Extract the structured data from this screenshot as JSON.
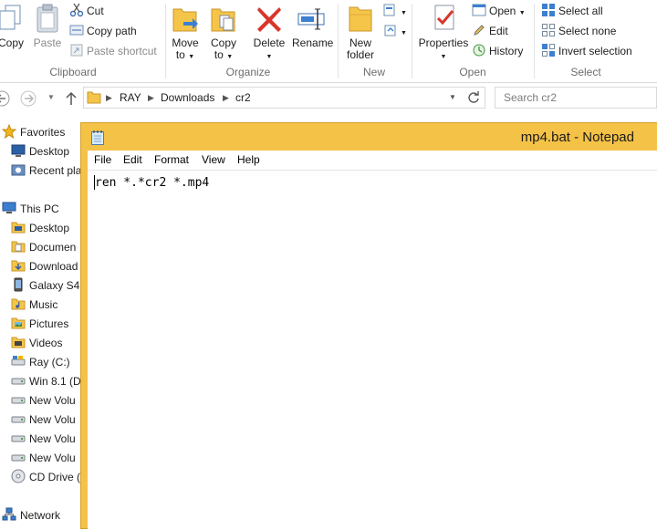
{
  "ribbon": {
    "clipboard": {
      "group_label": "Clipboard",
      "copy": "Copy",
      "paste": "Paste",
      "cut": "Cut",
      "copy_path": "Copy path",
      "paste_shortcut": "Paste shortcut"
    },
    "organize": {
      "group_label": "Organize",
      "move_to_1": "Move",
      "move_to_2": "to",
      "copy_to_1": "Copy",
      "copy_to_2": "to",
      "delete": "Delete",
      "rename": "Rename"
    },
    "new": {
      "group_label": "New",
      "new_folder_1": "New",
      "new_folder_2": "folder"
    },
    "open": {
      "group_label": "Open",
      "properties": "Properties",
      "open": "Open",
      "edit": "Edit",
      "history": "History"
    },
    "select": {
      "group_label": "Select",
      "select_all": "Select all",
      "select_none": "Select none",
      "invert_selection": "Invert selection"
    }
  },
  "address": {
    "crumbs": [
      "RAY",
      "Downloads",
      "cr2"
    ],
    "search_placeholder": "Search cr2"
  },
  "nav": {
    "items": [
      {
        "label": "Favorites",
        "icon": "star-icon"
      },
      {
        "label": "Desktop",
        "icon": "desktop-icon"
      },
      {
        "label": "Recent pla",
        "icon": "recent-places-icon"
      },
      {
        "label": "This PC",
        "icon": "computer-icon"
      },
      {
        "label": "Desktop",
        "icon": "folder-icon"
      },
      {
        "label": "Documen",
        "icon": "folder-icon"
      },
      {
        "label": "Download",
        "icon": "folder-icon"
      },
      {
        "label": "Galaxy S4",
        "icon": "phone-icon"
      },
      {
        "label": "Music",
        "icon": "folder-icon"
      },
      {
        "label": "Pictures",
        "icon": "folder-icon"
      },
      {
        "label": "Videos",
        "icon": "folder-icon"
      },
      {
        "label": "Ray (C:)",
        "icon": "drive-icon"
      },
      {
        "label": "Win 8.1 (D",
        "icon": "drive-icon"
      },
      {
        "label": "New Volu",
        "icon": "drive-icon"
      },
      {
        "label": "New Volu",
        "icon": "drive-icon"
      },
      {
        "label": "New Volu",
        "icon": "drive-icon"
      },
      {
        "label": "New Volu",
        "icon": "drive-icon"
      },
      {
        "label": "CD Drive (",
        "icon": "cd-drive-icon"
      },
      {
        "label": "Network",
        "icon": "network-icon"
      }
    ]
  },
  "notepad": {
    "title": "mp4.bat - Notepad",
    "menu": [
      "File",
      "Edit",
      "Format",
      "View",
      "Help"
    ],
    "content": "ren *.*cr2 *.mp4",
    "accent": "#f4c247"
  }
}
